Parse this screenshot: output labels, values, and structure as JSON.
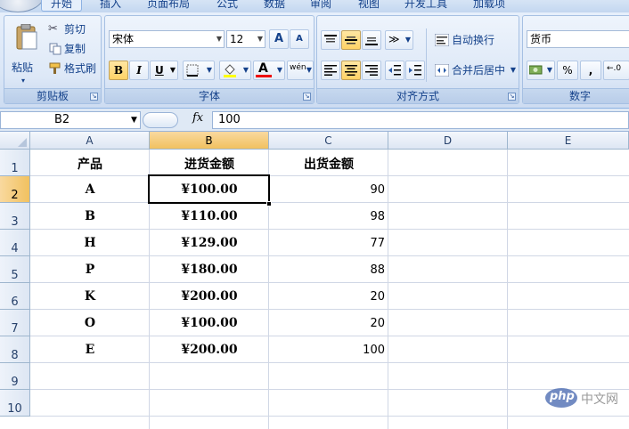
{
  "tabs": [
    {
      "label": "开始",
      "active": true
    },
    {
      "label": "插入"
    },
    {
      "label": "页面布局"
    },
    {
      "label": "公式"
    },
    {
      "label": "数据"
    },
    {
      "label": "审阅"
    },
    {
      "label": "视图"
    },
    {
      "label": "开发工具"
    },
    {
      "label": "加载项"
    }
  ],
  "ribbon": {
    "clipboard": {
      "title": "剪贴板",
      "paste": "粘贴",
      "cut": "剪切",
      "copy": "复制",
      "format_painter": "格式刷"
    },
    "font": {
      "title": "字体",
      "name": "宋体",
      "size": "12",
      "bold": "B",
      "italic": "I",
      "underline": "U",
      "font_color": "A",
      "grow": "A",
      "shrink": "A",
      "phonetic": "wén"
    },
    "alignment": {
      "title": "对齐方式",
      "wrap": "自动换行",
      "merge": "合并后居中"
    },
    "number": {
      "title": "数字",
      "format": "货币",
      "percent": "%",
      "comma": ","
    }
  },
  "formula_bar": {
    "name_box": "B2",
    "fx": "fx",
    "formula": "100"
  },
  "sheet": {
    "columns": [
      "A",
      "B",
      "C",
      "D",
      "E"
    ],
    "selected_column": "B",
    "rows": [
      "1",
      "2",
      "3",
      "4",
      "5",
      "6",
      "7",
      "8",
      "9",
      "10"
    ],
    "selected_row": "2",
    "header": {
      "a": "产品",
      "b": "进货金额",
      "c": "出货金额"
    },
    "data": [
      {
        "a": "A",
        "b": "¥100.00",
        "c": "90"
      },
      {
        "a": "B",
        "b": "¥110.00",
        "c": "98"
      },
      {
        "a": "H",
        "b": "¥129.00",
        "c": "77"
      },
      {
        "a": "P",
        "b": "¥180.00",
        "c": "88"
      },
      {
        "a": "K",
        "b": "¥200.00",
        "c": "20"
      },
      {
        "a": "O",
        "b": "¥100.00",
        "c": "20"
      },
      {
        "a": "E",
        "b": "¥200.00",
        "c": "100"
      }
    ]
  },
  "watermark": {
    "brand": "php",
    "site": "中文网"
  },
  "colors": {
    "selection": "#f1c15f",
    "ribbon": "#dbe7f7",
    "accent": "#15428b"
  }
}
